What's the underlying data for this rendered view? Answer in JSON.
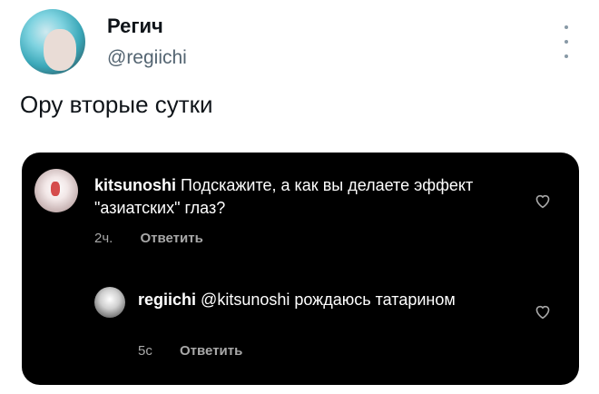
{
  "tweet": {
    "author_name": "Регич",
    "author_handle": "@regiichi",
    "text": "Ору вторые сутки"
  },
  "embedded_comments": [
    {
      "username": "kitsunoshi",
      "text": "Подскажите, а как вы делаете эффект \"азиатских\" глаз?",
      "time": "2ч.",
      "reply_label": "Ответить"
    },
    {
      "username": "regiichi",
      "text": "@kitsunoshi рождаюсь татарином",
      "time": "5с",
      "reply_label": "Ответить"
    }
  ]
}
